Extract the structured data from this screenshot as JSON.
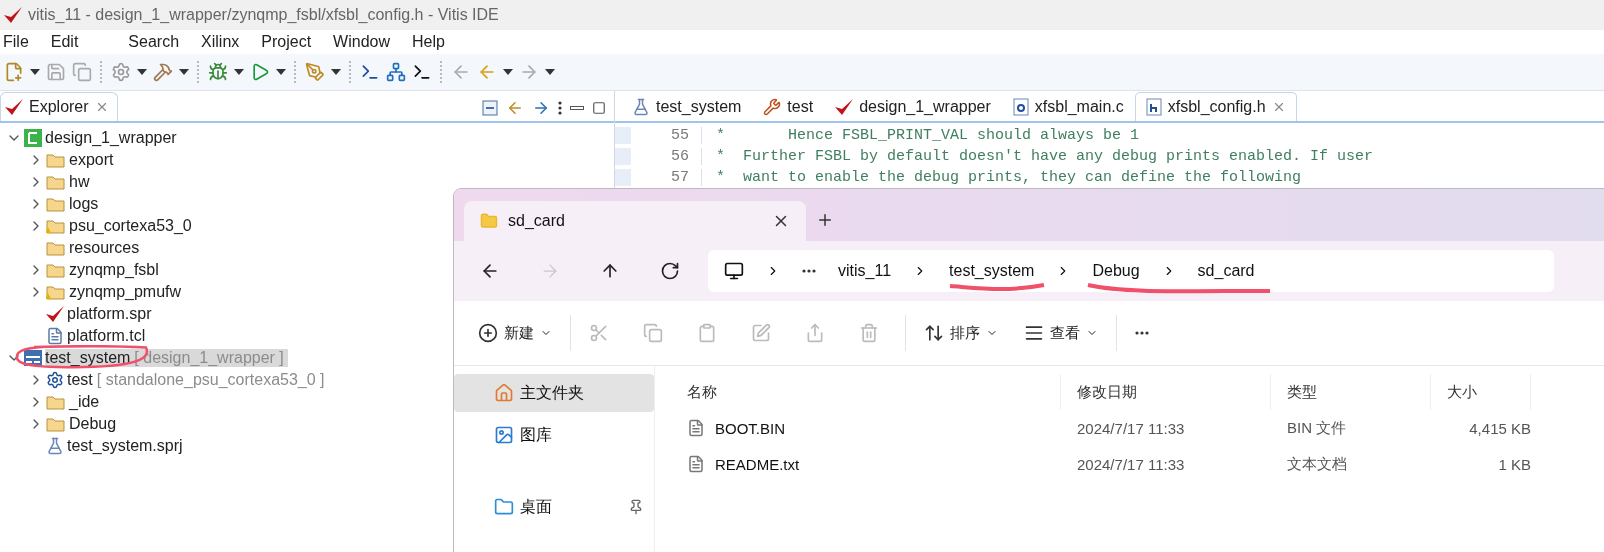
{
  "window": {
    "title": "vitis_11 - design_1_wrapper/zynqmp_fsbl/xfsbl_config.h - Vitis IDE"
  },
  "menu": [
    "File",
    "Edit",
    "Search",
    "Xilinx",
    "Project",
    "Window",
    "Help"
  ],
  "explorer": {
    "title": "Explorer",
    "tree": [
      {
        "label": "design_1_wrapper",
        "kind": "platform",
        "expanded": true,
        "selected": false,
        "children": [
          {
            "label": "export",
            "kind": "folder",
            "expanded": false,
            "selected": false
          },
          {
            "label": "hw",
            "kind": "folder",
            "expanded": false,
            "selected": false
          },
          {
            "label": "logs",
            "kind": "folder",
            "expanded": false,
            "selected": false
          },
          {
            "label": "psu_cortexa53_0",
            "kind": "warn-folder",
            "expanded": false,
            "selected": false
          },
          {
            "label": "resources",
            "kind": "folder",
            "selected": false
          },
          {
            "label": "zynqmp_fsbl",
            "kind": "folder",
            "expanded": false,
            "selected": false
          },
          {
            "label": "zynqmp_pmufw",
            "kind": "warn-folder",
            "expanded": false,
            "selected": false
          },
          {
            "label": "platform.spr",
            "kind": "spr",
            "selected": false
          },
          {
            "label": "platform.tcl",
            "kind": "text",
            "selected": false
          }
        ]
      },
      {
        "label": "test_system",
        "detail": "[ design_1_wrapper ]",
        "kind": "system",
        "expanded": true,
        "selected": true,
        "children": [
          {
            "label": "test",
            "detail": "[ standalone_psu_cortexa53_0 ]",
            "kind": "app",
            "expanded": false,
            "selected": false
          },
          {
            "label": "_ide",
            "kind": "folder",
            "expanded": false,
            "selected": false
          },
          {
            "label": "Debug",
            "kind": "folder",
            "expanded": false,
            "selected": false
          },
          {
            "label": "test_system.sprj",
            "kind": "sprj",
            "selected": false
          }
        ]
      }
    ]
  },
  "editor": {
    "tabs": [
      {
        "label": "test_system",
        "kind": "sprj",
        "selected": false
      },
      {
        "label": "test",
        "kind": "tools",
        "selected": false
      },
      {
        "label": "design_1_wrapper",
        "kind": "spr",
        "selected": false
      },
      {
        "label": "xfsbl_main.c",
        "kind": "c",
        "selected": false
      },
      {
        "label": "xfsbl_config.h",
        "kind": "h",
        "selected": true
      }
    ],
    "lines": [
      {
        "number": "55",
        "text": "*       Hence FSBL_PRINT_VAL should always be 1"
      },
      {
        "number": "56",
        "text": "*  Further FSBL by default doesn't have any debug prints enabled. If user"
      },
      {
        "number": "57",
        "text": "*  want to enable the debug prints, they can define the following"
      }
    ]
  },
  "file_explorer": {
    "tab": "sd_card",
    "nav": [
      {
        "kind": "back",
        "disabled": false
      },
      {
        "kind": "forward",
        "disabled": true
      },
      {
        "kind": "up",
        "disabled": false
      },
      {
        "kind": "refresh",
        "disabled": false
      }
    ],
    "breadcrumbs": [
      "vitis_11",
      "test_system",
      "Debug",
      "sd_card"
    ],
    "commands": [
      {
        "kind": "new",
        "label": "新建"
      },
      {
        "kind": "cut",
        "disabled": true
      },
      {
        "kind": "copy",
        "disabled": true
      },
      {
        "kind": "paste",
        "disabled": true
      },
      {
        "kind": "rename",
        "disabled": true
      },
      {
        "kind": "share",
        "disabled": true
      },
      {
        "kind": "delete",
        "disabled": true
      },
      {
        "kind": "sort",
        "label": "排序"
      },
      {
        "kind": "view",
        "label": "查看"
      },
      {
        "kind": "more"
      }
    ],
    "sidebar": [
      {
        "label": "主文件夹",
        "kind": "home",
        "selected": true
      },
      {
        "label": "图库",
        "kind": "gallery",
        "selected": false
      },
      {
        "label": "桌面",
        "kind": "desktop",
        "selected": false,
        "pinned": true
      }
    ],
    "columns": [
      "名称",
      "修改日期",
      "类型",
      "大小"
    ],
    "rows": [
      {
        "name": "BOOT.BIN",
        "modified": "2024/7/17 11:33",
        "type": "BIN 文件",
        "size": "4,415 KB"
      },
      {
        "name": "README.txt",
        "modified": "2024/7/17 11:33",
        "type": "文本文档",
        "size": "1 KB"
      }
    ]
  }
}
